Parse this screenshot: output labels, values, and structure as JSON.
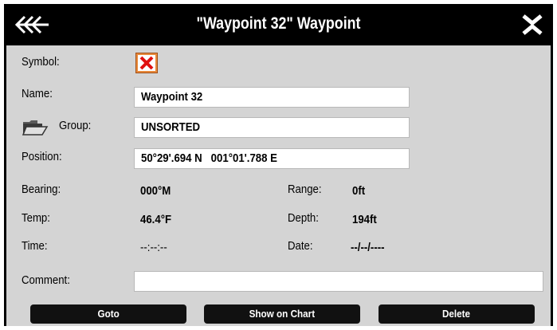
{
  "dialog": {
    "title": "\"Waypoint 32\" Waypoint",
    "back_icon": "back-chevrons-icon",
    "close_icon": "close-x-icon"
  },
  "fields": {
    "symbol_label": "Symbol:",
    "symbol_icon": "red-x-symbol-icon",
    "name_label": "Name:",
    "name_value": "Waypoint 32",
    "group_label": "Group:",
    "group_icon": "folder-icon",
    "group_value": "UNSORTED",
    "position_label": "Position:",
    "position_value": "50°29'.694 N   001°01'.788 E",
    "bearing_label": "Bearing:",
    "bearing_value": "000°M",
    "range_label": "Range:",
    "range_value": "0ft",
    "temp_label": "Temp:",
    "temp_value": "46.4°F",
    "depth_label": "Depth:",
    "depth_value": "194ft",
    "time_label": "Time:",
    "time_value": "--:--:--",
    "date_label": "Date:",
    "date_value": "--/--/----",
    "comment_label": "Comment:",
    "comment_value": ""
  },
  "buttons": {
    "goto": "Goto",
    "show_on_chart": "Show on Chart",
    "delete": "Delete"
  },
  "colors": {
    "titlebar": "#000000",
    "panel": "#d4d4d4",
    "symbol_bg": "#e8893a",
    "symbol_x": "#e01010"
  }
}
